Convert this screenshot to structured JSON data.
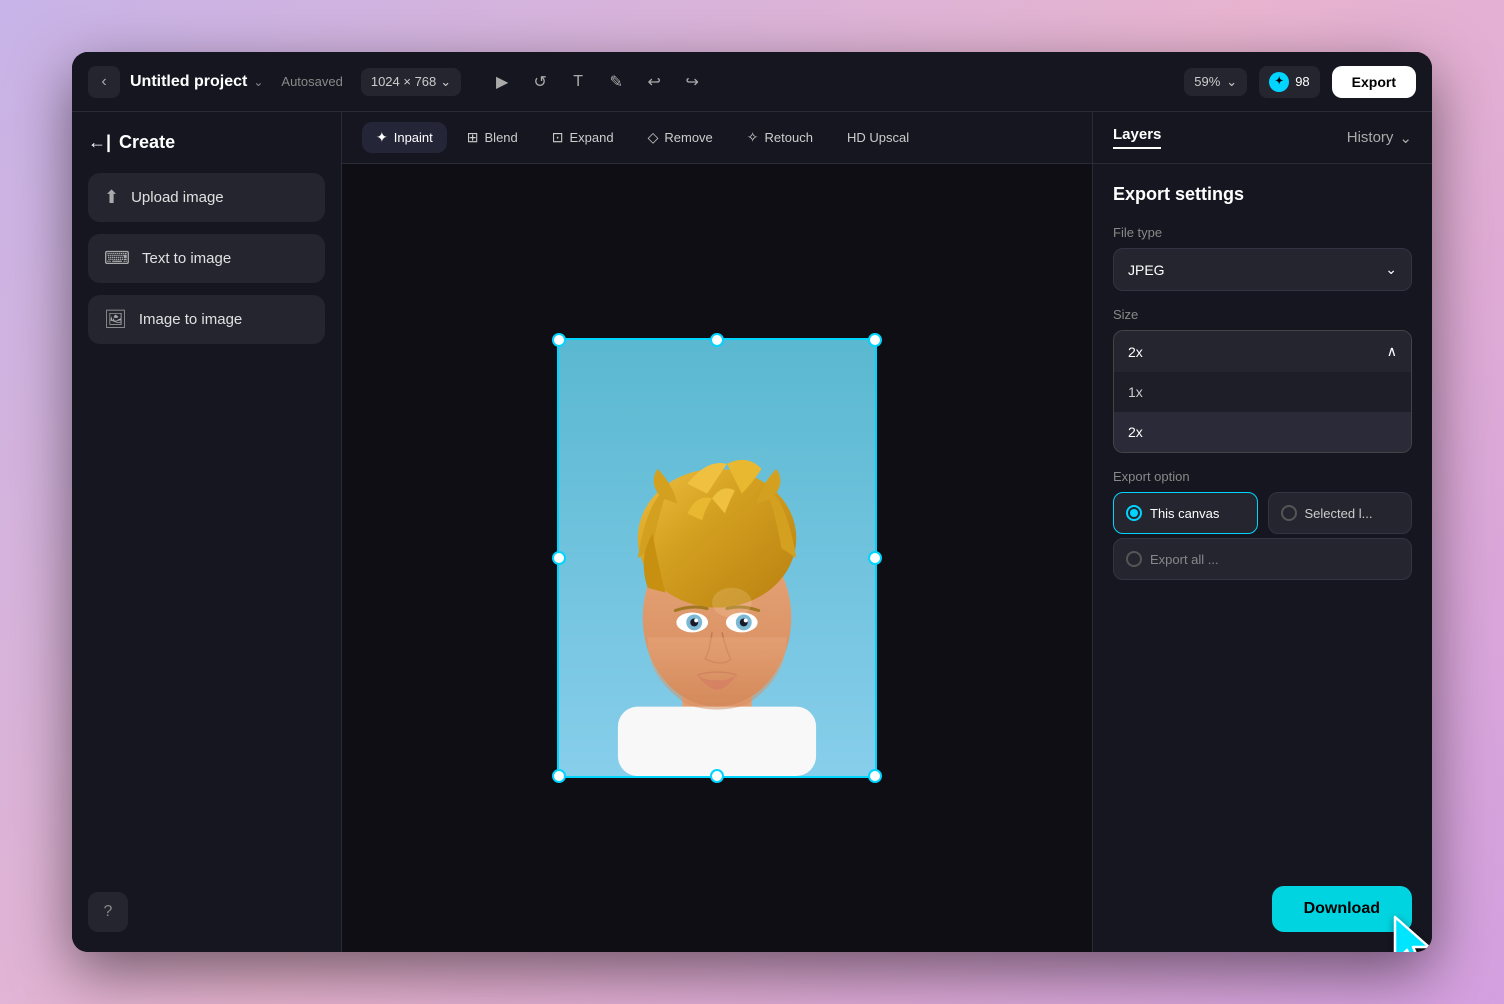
{
  "app": {
    "project_name": "Untitled project",
    "autosaved": "Autosaved",
    "canvas_size": "1024 × 768",
    "zoom": "59%",
    "credits": "98",
    "export_label": "Export"
  },
  "sidebar": {
    "header": "Create",
    "items": [
      {
        "id": "upload-image",
        "label": "Upload image",
        "icon": "⬆"
      },
      {
        "id": "text-to-image",
        "label": "Text to image",
        "icon": "⌨"
      },
      {
        "id": "image-to-image",
        "label": "Image to image",
        "icon": "🖼"
      }
    ]
  },
  "edit_toolbar": {
    "tools": [
      {
        "id": "inpaint",
        "label": "Inpaint",
        "active": true,
        "icon": "✦"
      },
      {
        "id": "blend",
        "label": "Blend",
        "active": false,
        "icon": "⊞"
      },
      {
        "id": "expand",
        "label": "Expand",
        "active": false,
        "icon": "⊡"
      },
      {
        "id": "remove",
        "label": "Remove",
        "active": false,
        "icon": "◇"
      },
      {
        "id": "retouch",
        "label": "Retouch",
        "active": false,
        "icon": "✧"
      },
      {
        "id": "upscal",
        "label": "HD Upscal",
        "active": false,
        "icon": "HD"
      }
    ]
  },
  "right_panel": {
    "tabs": [
      {
        "id": "layers",
        "label": "Layers",
        "active": true
      },
      {
        "id": "history",
        "label": "History",
        "active": false
      }
    ],
    "export_settings": {
      "title": "Export settings",
      "file_type_label": "File type",
      "file_type_value": "JPEG",
      "size_label": "Size",
      "size_value": "2x",
      "size_options": [
        "1x",
        "2x"
      ],
      "export_option_label": "Export option",
      "export_options": [
        {
          "id": "this-canvas",
          "label": "This canvas",
          "active": true
        },
        {
          "id": "selected",
          "label": "Selected l...",
          "active": false
        }
      ],
      "export_all_label": "Export all ...",
      "download_label": "Download"
    }
  },
  "toolbar": {
    "back_icon": "‹",
    "chevron": "⌄",
    "tools": [
      "▶",
      "↺",
      "T",
      "✎",
      "↩",
      "↪"
    ]
  }
}
